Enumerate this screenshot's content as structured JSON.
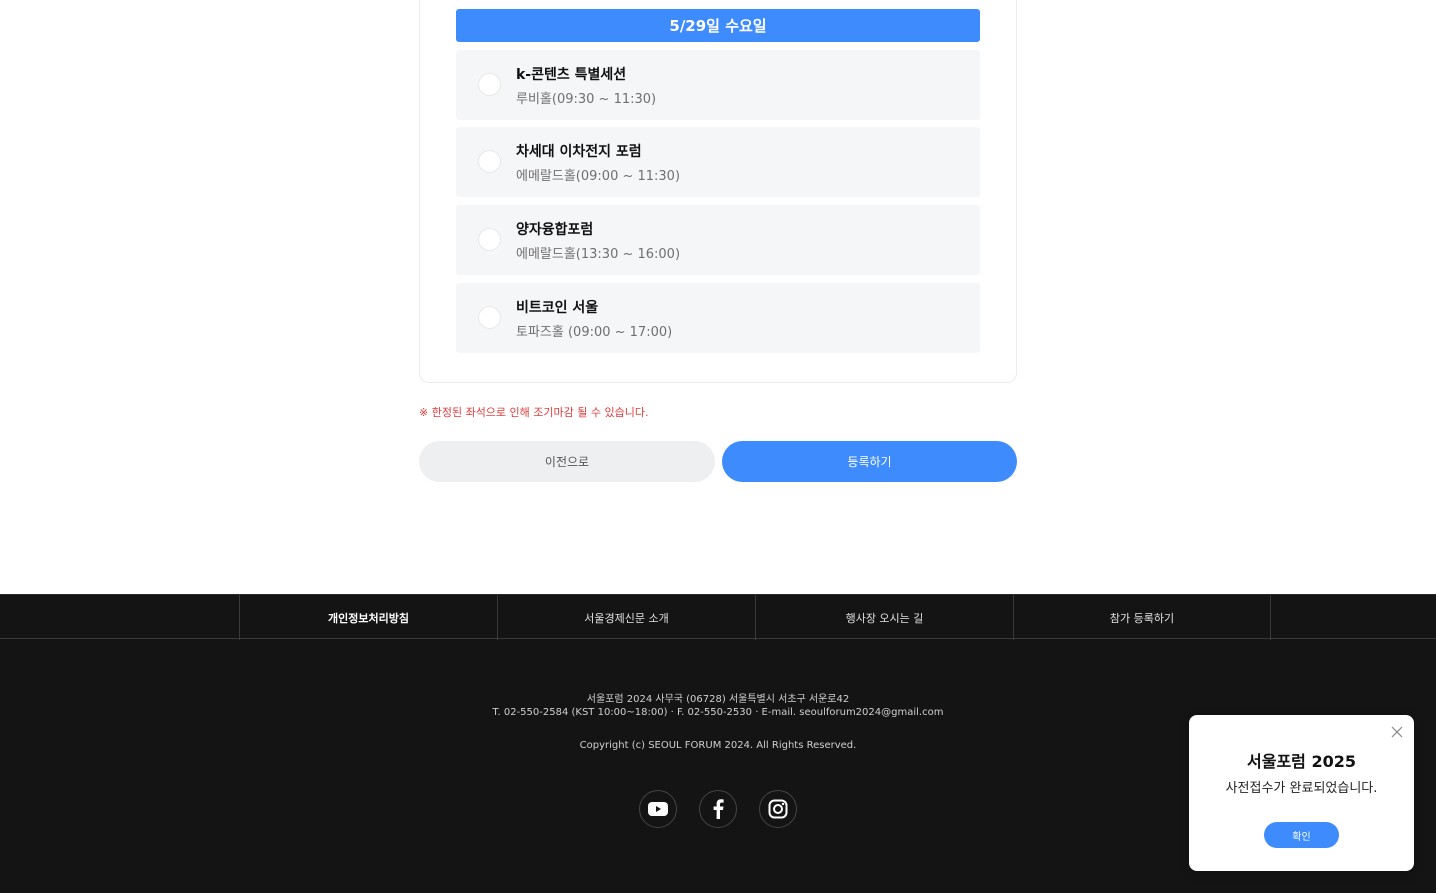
{
  "schedule": {
    "date_header": "5/29일 수요일",
    "sessions": [
      {
        "title": "k-콘텐츠 특별세션",
        "time": "루비홀(09:30 ~ 11:30)"
      },
      {
        "title": "차세대 이차전지 포럼",
        "time": "에메랄드홀(09:00 ~ 11:30)"
      },
      {
        "title": "양자융합포럼",
        "time": "에메랄드홀(13:30 ~ 16:00)"
      },
      {
        "title": "비트코인 서울",
        "time": "토파즈홀 (09:00 ~ 17:00)"
      }
    ]
  },
  "notice": "※ 한정된 좌석으로 인해 조기마감 될 수 있습니다.",
  "buttons": {
    "prev": "이전으로",
    "submit": "등록하기"
  },
  "footer": {
    "nav": [
      "개인정보처리방침",
      "서울경제신문 소개",
      "행사장 오시는 길",
      "참가 등록하기"
    ],
    "address": "서울포럼 2024 사무국 (06728) 서울특별시 서초구 서운로42",
    "contact": "T. 02-550-2584 (KST 10:00~18:00) · F. 02-550-2530 · E-mail. seoulforum2024@gmail.com",
    "copyright": "Copyright (c) SEOUL FORUM 2024. All Rights Reserved.",
    "social_icons": [
      "youtube-icon",
      "facebook-icon",
      "instagram-icon"
    ]
  },
  "modal": {
    "title": "서울포럼 2025",
    "message": "사전접수가 완료되었습니다.",
    "confirm": "확인"
  },
  "colors": {
    "accent": "#3d8bfd",
    "notice": "#e03a3a",
    "footer_bg": "#141414"
  }
}
